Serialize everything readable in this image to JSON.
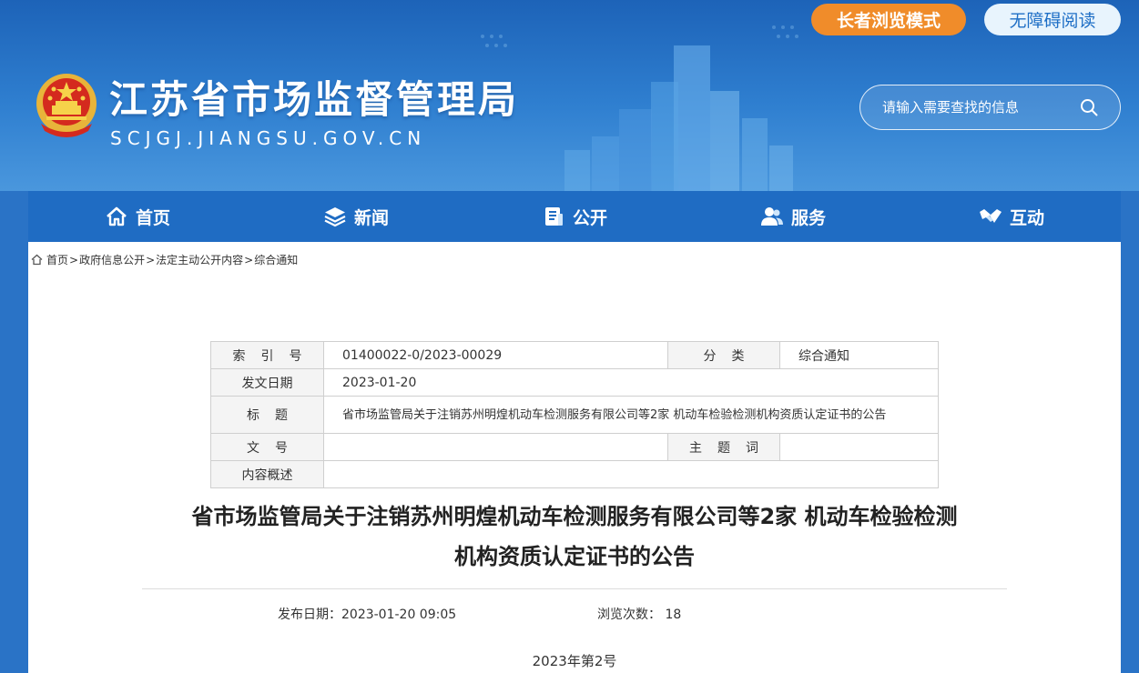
{
  "header": {
    "site_title": "江苏省市场监督管理局",
    "site_domain": "SCJGJ.JIANGSU.GOV.CN",
    "elder_mode_label": "长者浏览模式",
    "accessible_label": "无障碍阅读",
    "search_placeholder": "请输入需要查找的信息"
  },
  "nav": {
    "items": [
      {
        "label": "首页",
        "icon": "home-icon"
      },
      {
        "label": "新闻",
        "icon": "layers-icon"
      },
      {
        "label": "公开",
        "icon": "document-stack-icon"
      },
      {
        "label": "服务",
        "icon": "users-icon"
      },
      {
        "label": "互动",
        "icon": "handshake-icon"
      }
    ]
  },
  "breadcrumb": {
    "items": [
      "首页",
      "政府信息公开",
      "法定主动公开内容",
      "综合通知"
    ],
    "separator": ">"
  },
  "meta": {
    "index_label": "索 引 号",
    "index_value": "01400022-0/2023-00029",
    "category_label": "分 类",
    "category_value": "综合通知",
    "date_label": "发文日期",
    "date_value": "2023-01-20",
    "title_label": "标 题",
    "title_value": "省市场监管局关于注销苏州明煌机动车检测服务有限公司等2家 机动车检验检测机构资质认定证书的公告",
    "docno_label": "文 号",
    "docno_value": "",
    "subject_label": "主 题 词",
    "subject_value": "",
    "summary_label": "内容概述",
    "summary_value": ""
  },
  "article": {
    "title_line1": "省市场监管局关于注销苏州明煌机动车检测服务有限公司等2家 机动车检验检测",
    "title_line2": "机构资质认定证书的公告",
    "publish_label": "发布日期：",
    "publish_value": "2023-01-20 09:05",
    "views_label": "浏览次数：",
    "views_value": "18",
    "doc_number": "2023年第2号"
  },
  "colors": {
    "header_blue": "#1d63b8",
    "nav_blue": "#1f6cc3",
    "elder_orange": "#f08c2a"
  }
}
